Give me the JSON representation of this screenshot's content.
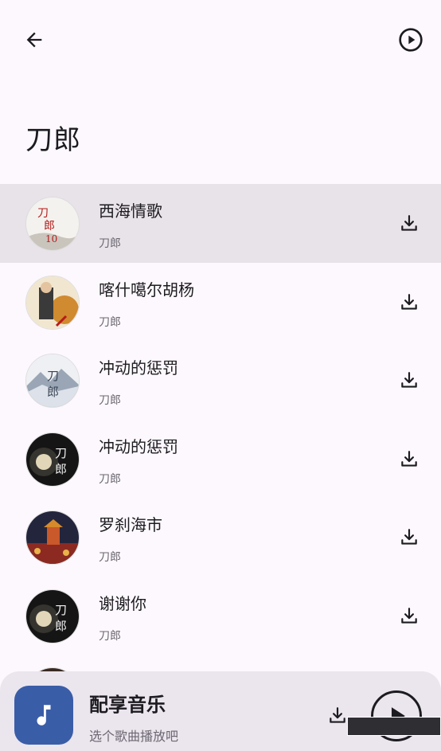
{
  "page": {
    "title": "刀郎"
  },
  "header": {
    "back_icon": "arrow-left-icon",
    "play_all_icon": "play-circle-icon"
  },
  "songs": [
    {
      "title": "西海情歌",
      "artist": "刀郎",
      "selected": true
    },
    {
      "title": "喀什噶尔胡杨",
      "artist": "刀郎",
      "selected": false
    },
    {
      "title": "冲动的惩罚",
      "artist": "刀郎",
      "selected": false
    },
    {
      "title": "冲动的惩罚",
      "artist": "刀郎",
      "selected": false
    },
    {
      "title": "罗刹海市",
      "artist": "刀郎",
      "selected": false
    },
    {
      "title": "谢谢你",
      "artist": "刀郎",
      "selected": false
    },
    {
      "title": "",
      "artist": "",
      "selected": false
    }
  ],
  "player": {
    "title": "配享音乐",
    "subtitle": "选个歌曲播放吧",
    "app_icon": "music-note-icon",
    "download_icon": "download-icon",
    "play_icon": "play-icon"
  },
  "colors": {
    "selected_row": "#e8e2e9",
    "app_icon_bg": "#3a5da8",
    "background": "#fdf8fd"
  }
}
